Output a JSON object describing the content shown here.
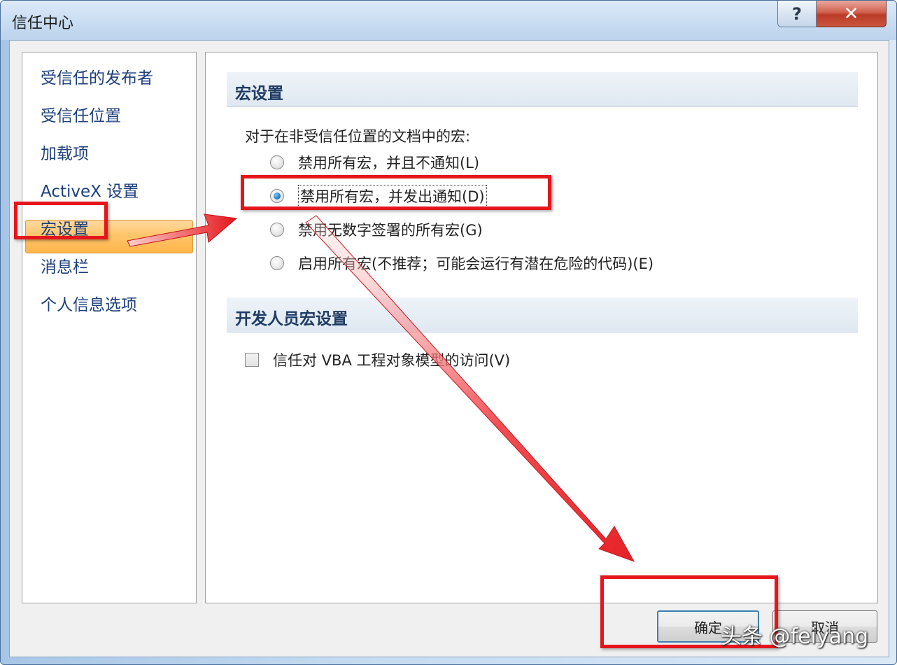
{
  "window": {
    "title": "信任中心",
    "help_label": "?",
    "close_label": "✕"
  },
  "sidebar": {
    "items": [
      {
        "label": "受信任的发布者"
      },
      {
        "label": "受信任位置"
      },
      {
        "label": "加载项"
      },
      {
        "label": "ActiveX 设置"
      },
      {
        "label": "宏设置",
        "selected": true
      },
      {
        "label": "消息栏"
      },
      {
        "label": "个人信息选项"
      }
    ]
  },
  "macro_section": {
    "title": "宏设置",
    "intro": "对于在非受信任位置的文档中的宏:",
    "options": [
      {
        "label": "禁用所有宏，并且不通知(L)",
        "checked": false
      },
      {
        "label": "禁用所有宏，并发出通知(D)",
        "checked": true
      },
      {
        "label": "禁用无数字签署的所有宏(G)",
        "checked": false
      },
      {
        "label": "启用所有宏(不推荐；可能会运行有潜在危险的代码)(E)",
        "checked": false
      }
    ]
  },
  "developer_section": {
    "title": "开发人员宏设置",
    "checkbox_label": "信任对 VBA 工程对象模型的访问(V)",
    "checked": false
  },
  "buttons": {
    "ok_label": "确定",
    "cancel_label": "取消"
  },
  "watermark": "头条 @feiyang",
  "annotation_color": "#e5161b"
}
